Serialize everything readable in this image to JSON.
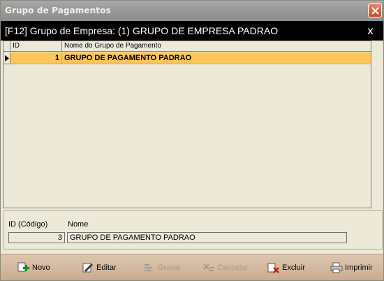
{
  "window": {
    "title": "Grupo de Pagamentos"
  },
  "group_bar": {
    "text": "[F12] Grupo de Empresa: (1) GRUPO DE EMPRESA PADRAO",
    "close_glyph": "x"
  },
  "grid": {
    "columns": [
      "ID",
      "Nome do Grupo de Pagamento"
    ],
    "rows": [
      {
        "id": "1",
        "name": "GRUPO DE PAGAMENTO PADRAO"
      }
    ],
    "selected_color": "#ffc55a"
  },
  "form": {
    "id_label": "ID (Código)",
    "name_label": "Nome",
    "id_value": "3",
    "name_value": "GRUPO DE PAGAMENTO PADRAO"
  },
  "toolbar": {
    "novo": {
      "label": "Novo",
      "icon": "add-icon",
      "enabled": true
    },
    "editar": {
      "label": "Editar",
      "icon": "edit-icon",
      "enabled": true
    },
    "gravar": {
      "label": "Gravar",
      "icon": "save-icon",
      "enabled": false
    },
    "cancelar": {
      "label": "Cancelar",
      "icon": "cancel-icon",
      "enabled": false
    },
    "excluir": {
      "label": "Excluir",
      "icon": "delete-icon",
      "enabled": true
    },
    "imprimir": {
      "label": "Imprimir",
      "icon": "print-icon",
      "enabled": true
    }
  }
}
